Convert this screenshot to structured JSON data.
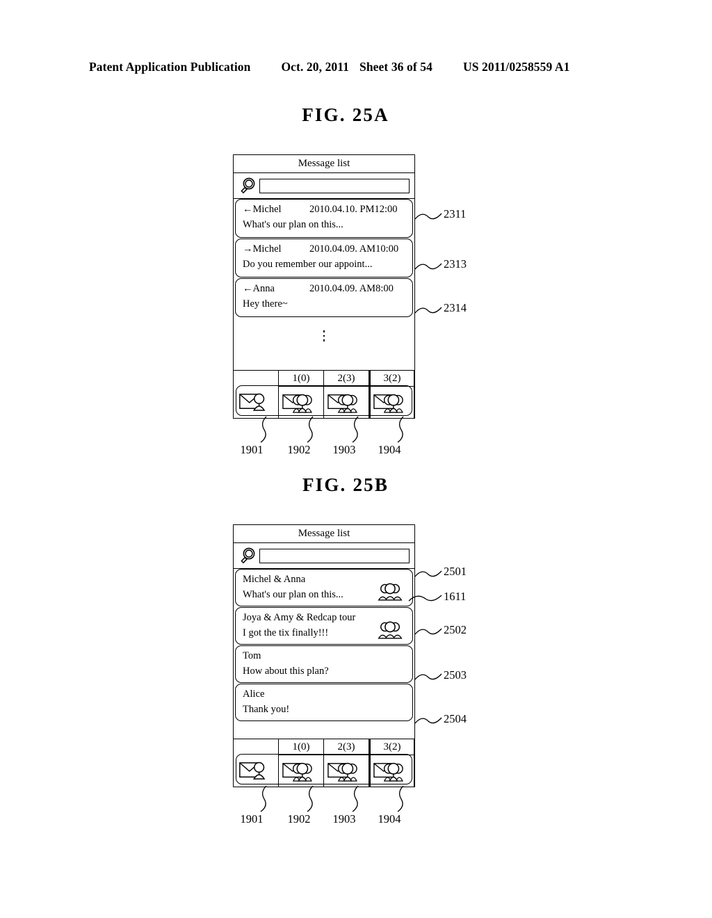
{
  "header": {
    "title": "Patent Application Publication",
    "date": "Oct. 20, 2011",
    "sheet": "Sheet 36 of 54",
    "patent_number": "US 2011/0258559 A1"
  },
  "figures": [
    {
      "id": "25a",
      "title": "FIG. 25A",
      "screen": {
        "title_bar": "Message list",
        "search": {
          "icon": "magnifier-icon",
          "value": "",
          "placeholder": ""
        },
        "messages": [
          {
            "direction": "←",
            "name": "Michel",
            "timestamp": "2010.04.10. PM12:00",
            "preview": "What's our plan on this...",
            "ref": "2311"
          },
          {
            "direction": "→",
            "name": "Michel",
            "timestamp": "2010.04.09. AM10:00",
            "preview": "Do you remember our appoint...",
            "ref": "2313"
          },
          {
            "direction": "←",
            "name": "Anna",
            "timestamp": "2010.04.09. AM8:00",
            "preview": "Hey there~",
            "ref": "2314"
          }
        ],
        "ellipsis": "⋮",
        "tabs": [
          {
            "label": "",
            "icon": "single-message-icon",
            "ref": "1901",
            "selected": false
          },
          {
            "label": "1(0)",
            "icon": "group-message-icon",
            "ref": "1902",
            "selected": false
          },
          {
            "label": "2(3)",
            "icon": "group-message-icon",
            "ref": "1903",
            "selected": false
          },
          {
            "label": "3(2)",
            "icon": "group-message-icon",
            "ref": "1904",
            "selected": true
          }
        ]
      }
    },
    {
      "id": "25b",
      "title": "FIG. 25B",
      "screen": {
        "title_bar": "Message list",
        "search": {
          "icon": "magnifier-icon",
          "value": "",
          "placeholder": ""
        },
        "messages": [
          {
            "name": "Michel & Anna",
            "preview": "What's our plan on this...",
            "icon": "group-members-icon",
            "ref": "2501",
            "icon_ref": "1611"
          },
          {
            "name": "Joya & Amy & Redcap tour",
            "preview": "I got the tix finally!!!",
            "icon": "group-members-icon",
            "ref": "2502",
            "icon_ref": ""
          },
          {
            "name": "Tom",
            "preview": "How about this plan?",
            "icon": "",
            "ref": "2503",
            "icon_ref": ""
          },
          {
            "name": "Alice",
            "preview": "Thank you!",
            "icon": "",
            "ref": "2504",
            "icon_ref": ""
          }
        ],
        "tabs": [
          {
            "label": "",
            "icon": "single-message-icon",
            "ref": "1901",
            "selected": false
          },
          {
            "label": "1(0)",
            "icon": "group-message-icon",
            "ref": "1902",
            "selected": false
          },
          {
            "label": "2(3)",
            "icon": "group-message-icon",
            "ref": "1903",
            "selected": false
          },
          {
            "label": "3(2)",
            "icon": "group-message-icon",
            "ref": "1904",
            "selected": true
          }
        ]
      }
    }
  ],
  "colors": {
    "ink": "#000000",
    "paper": "#ffffff"
  }
}
